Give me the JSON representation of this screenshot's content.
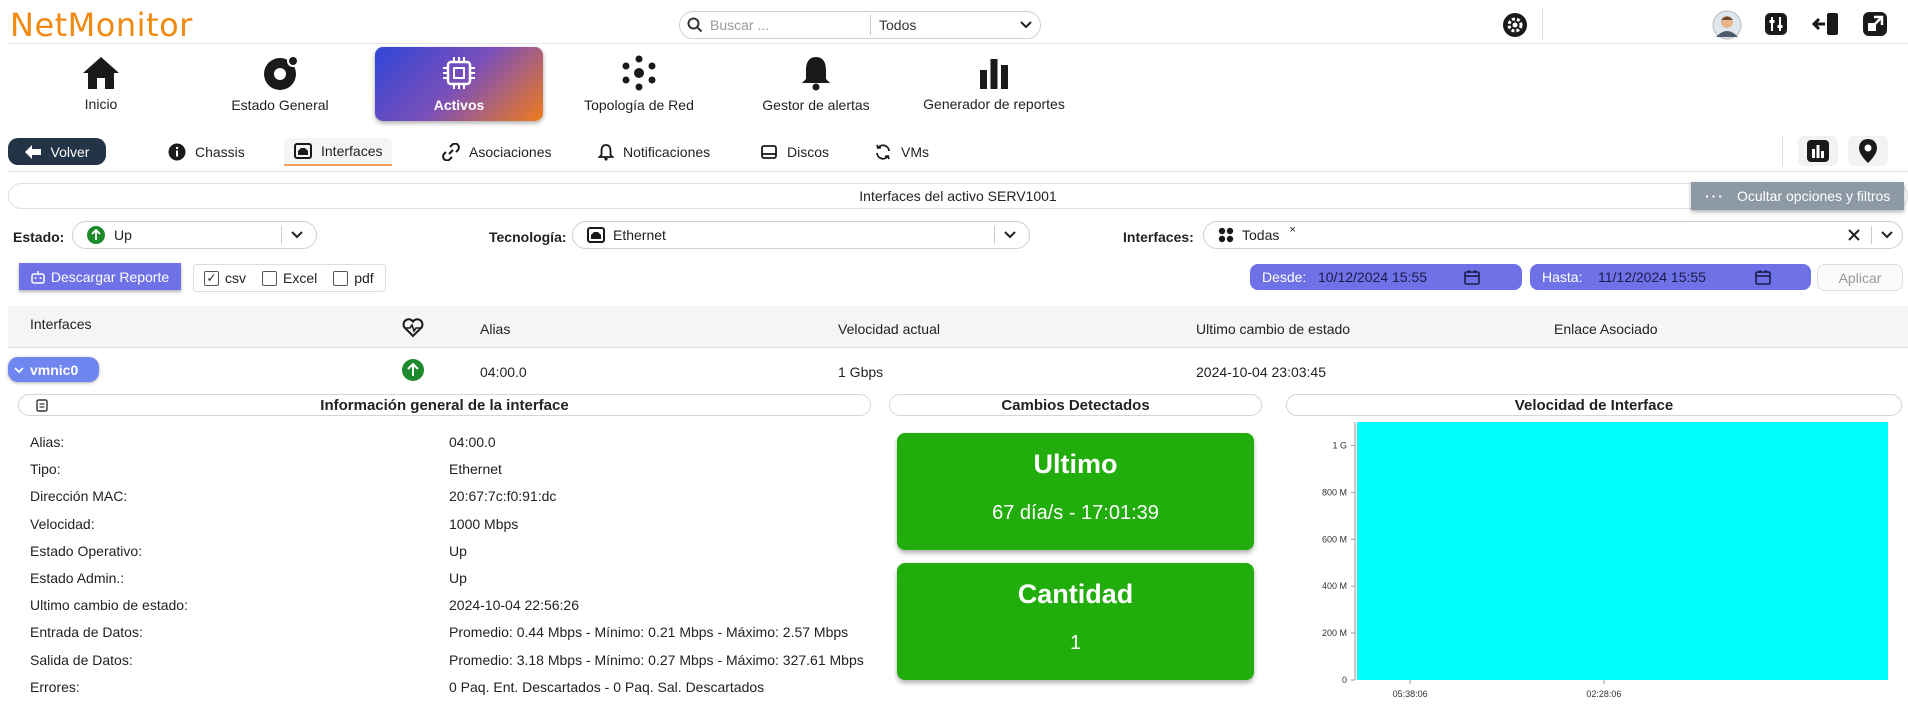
{
  "app": {
    "logo": "NetMonitor"
  },
  "search": {
    "placeholder": "Buscar ...",
    "scope": "Todos"
  },
  "topbar": {
    "icons": [
      "gear-icon",
      "user-avatar",
      "equalizer-icon",
      "logout-icon",
      "external-link-icon"
    ]
  },
  "nav": [
    {
      "label": "Inicio",
      "icon": "home-icon"
    },
    {
      "label": "Estado General",
      "icon": "dashboard-icon"
    },
    {
      "label": "Activos",
      "icon": "chip-icon",
      "active": true
    },
    {
      "label": "Topología de Red",
      "icon": "network-icon"
    },
    {
      "label": "Gestor de alertas",
      "icon": "bell-icon"
    },
    {
      "label": "Generador de reportes",
      "icon": "bar-chart-icon"
    }
  ],
  "subnav": {
    "back_label": "Volver",
    "tabs": [
      {
        "label": "Chassis",
        "icon": "info-icon"
      },
      {
        "label": "Interfaces",
        "icon": "interface-icon",
        "active": true
      },
      {
        "label": "Asociaciones",
        "icon": "link-icon"
      },
      {
        "label": "Notificaciones",
        "icon": "bell-icon"
      },
      {
        "label": "Discos",
        "icon": "disk-icon"
      },
      {
        "label": "VMs",
        "icon": "refresh-icon"
      }
    ]
  },
  "page": {
    "title": "Interfaces del activo SERV1001",
    "toggle_filters": "Ocultar opciones y filtros"
  },
  "filters": {
    "estado_label": "Estado:",
    "estado_value": "Up",
    "tecnologia_label": "Tecnología:",
    "tecnologia_value": "Ethernet",
    "interfaces_label": "Interfaces:",
    "interfaces_value": "Todas",
    "interfaces_remove": "×"
  },
  "report": {
    "download_label": "Descargar Reporte",
    "formats": [
      {
        "label": "csv",
        "checked": true
      },
      {
        "label": "Excel",
        "checked": false
      },
      {
        "label": "pdf",
        "checked": false
      }
    ],
    "desde_label": "Desde:",
    "desde_value": "10/12/2024 15:55",
    "hasta_label": "Hasta:",
    "hasta_value": "11/12/2024 15:55",
    "apply_label": "Aplicar"
  },
  "table": {
    "headers": {
      "interface": "Interfaces",
      "alias": "Alias",
      "speed": "Velocidad actual",
      "last_change": "Ultimo cambio de estado",
      "link": "Enlace Asociado"
    },
    "row": {
      "interface": "vmnic0",
      "alias": "04:00.0",
      "speed": "1 Gbps",
      "last_change": "2024-10-04 23:03:45",
      "link": ""
    }
  },
  "info": {
    "title": "Información general de la interface",
    "rows": [
      {
        "k": "Alias:",
        "v": "04:00.0"
      },
      {
        "k": "Tipo:",
        "v": "Ethernet"
      },
      {
        "k": "Dirección MAC:",
        "v": "20:67:7c:f0:91:dc"
      },
      {
        "k": "Velocidad:",
        "v": "1000 Mbps"
      },
      {
        "k": "Estado Operativo:",
        "v": "Up"
      },
      {
        "k": "Estado Admin.:",
        "v": "Up"
      },
      {
        "k": "Ultimo cambio de estado:",
        "v": "2024-10-04 22:56:26"
      },
      {
        "k": "Entrada de Datos:",
        "v": "Promedio: 0.44 Mbps - Mínimo: 0.21 Mbps - Máximo: 2.57 Mbps"
      },
      {
        "k": "Salida de Datos:",
        "v": "Promedio: 3.18 Mbps - Mínimo: 0.27 Mbps - Máximo: 327.61 Mbps"
      },
      {
        "k": "Errores:",
        "v": "0 Paq. Ent. Descartados - 0 Paq. Sal. Descartados"
      }
    ]
  },
  "changes": {
    "title": "Cambios Detectados",
    "last_label": "Ultimo",
    "last_value": "67 día/s - 17:01:39",
    "count_label": "Cantidad",
    "count_value": "1"
  },
  "colors": {
    "accent": "#6f71e6",
    "green": "#21ad0b",
    "chart_fill": "#00ffff"
  },
  "chart_data": {
    "type": "area",
    "title": "Velocidad de Interface",
    "yticks": [
      "0",
      "200 M",
      "400 M",
      "600 M",
      "800 M",
      "1 G"
    ],
    "ylim": [
      0,
      1100000000
    ],
    "xticks": [
      "05:38:06",
      "02:28:06"
    ],
    "series": [
      {
        "values": [
          1100000000,
          1100000000
        ]
      }
    ]
  }
}
